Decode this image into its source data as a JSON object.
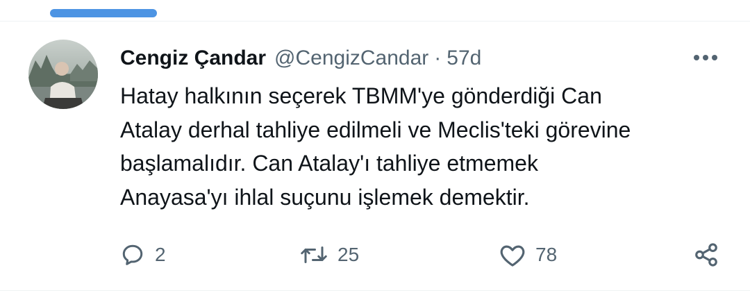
{
  "tweet": {
    "author": {
      "display_name": "Cengiz Çandar",
      "handle": "@CengizCandar",
      "separator": "·",
      "time_ago": "57d"
    },
    "text_lines": [
      "Hatay halkının seçerek TBMM'ye gönderdiği Can",
      "Atalay derhal tahliye edilmeli ve Meclis'teki görevine",
      "başlamalıdır. Can Atalay'ı tahliye etmemek",
      "Anayasa'yı ihlal suçunu işlemek demektir."
    ],
    "actions": {
      "reply": {
        "icon": "reply-icon",
        "count": "2"
      },
      "retweet": {
        "icon": "retweet-icon",
        "count": "25"
      },
      "like": {
        "icon": "heart-icon",
        "count": "78"
      },
      "share": {
        "icon": "share-icon"
      }
    },
    "more_icon": "more-options-icon"
  },
  "colors": {
    "accent": "#4d94e3",
    "text_primary": "#0f1419",
    "text_secondary": "#536471",
    "divider": "#eff3f4"
  }
}
